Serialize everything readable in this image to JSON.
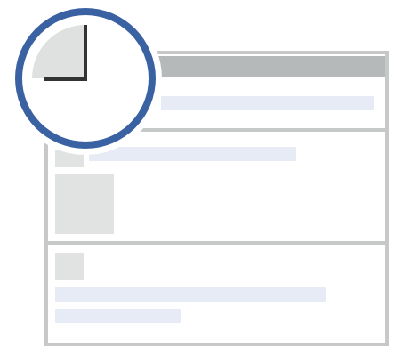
{
  "illustration": {
    "subject": "scheduled-post-timeline",
    "icons": {
      "clock": "clock-icon",
      "post_window": "post-feed-icon"
    },
    "colors": {
      "clock_ring": "#3A62A3",
      "clock_face": "#FFFFFF",
      "clock_wedge": "#DFE1E1",
      "clock_hands": "#333333",
      "frame_border": "#C7C9C9",
      "frame_header": "#B6B9B9",
      "card_background": "#FFFFFF",
      "placeholder_blue": "#E7EBF6",
      "placeholder_gray": "#E1E3E3"
    },
    "clock": {
      "hour_hand": "12",
      "minute_hand": "9",
      "shaded_quarter": "top-left"
    },
    "feed": {
      "card_count": 3
    }
  }
}
